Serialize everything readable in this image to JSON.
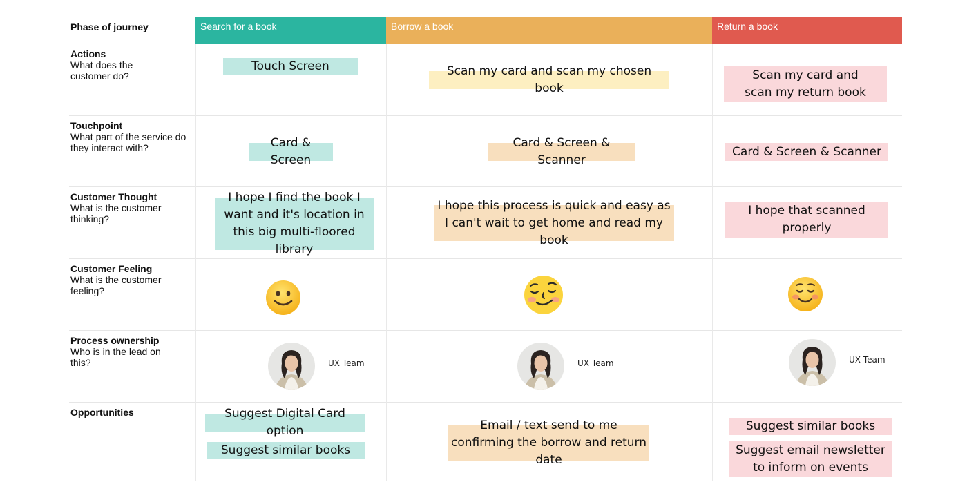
{
  "header": {
    "phase_label": "Phase of journey",
    "phases": [
      {
        "label": "Search for a book",
        "color": "#2bb5a0"
      },
      {
        "label": "Borrow a book",
        "color": "#eab05a"
      },
      {
        "label": "Return a book",
        "color": "#e05a4f"
      }
    ]
  },
  "rows": [
    {
      "title": "Actions",
      "subtitle": "What does the customer do?"
    },
    {
      "title": "Touchpoint",
      "subtitle": "What part of the service do they interact with?"
    },
    {
      "title": "Customer Thought",
      "subtitle": "What is the customer thinking?"
    },
    {
      "title": "Customer Feeling",
      "subtitle": "What is the customer feeling?"
    },
    {
      "title": "Process ownership",
      "subtitle": "Who is in the lead on this?"
    },
    {
      "title": "Opportunities",
      "subtitle": ""
    }
  ],
  "notes": {
    "actions": [
      "Touch Screen",
      "Scan my card and scan my chosen book",
      "Scan my card and scan my return book"
    ],
    "touchpoint": [
      "Card & Screen",
      "Card & Screen & Scanner",
      "Card & Screen & Scanner"
    ],
    "thought": [
      "I hope I find the book I want and it's location in this big multi-floored library",
      "I hope this process is quick and easy as I can't wait to get home and read my book",
      "I hope that scanned properly"
    ],
    "feeling_icons": [
      "slightly-smiling-face-icon",
      "relieved-face-icon",
      "smiling-face-icon"
    ],
    "ownership": [
      "UX Team",
      "UX Team",
      "UX Team"
    ],
    "opportunities": {
      "search": [
        "Suggest Digital Card option",
        "Suggest similar books"
      ],
      "borrow": [
        "Email / text send to me confirming the borrow and return date"
      ],
      "return": [
        "Suggest similar books",
        "Suggest email newsletter to inform on events"
      ]
    }
  },
  "colors": {
    "teal_note": "#bfe8e2",
    "yellow_note": "#fdefc1",
    "peach_note": "#f8dfbe",
    "pink_note": "#fad8db"
  }
}
